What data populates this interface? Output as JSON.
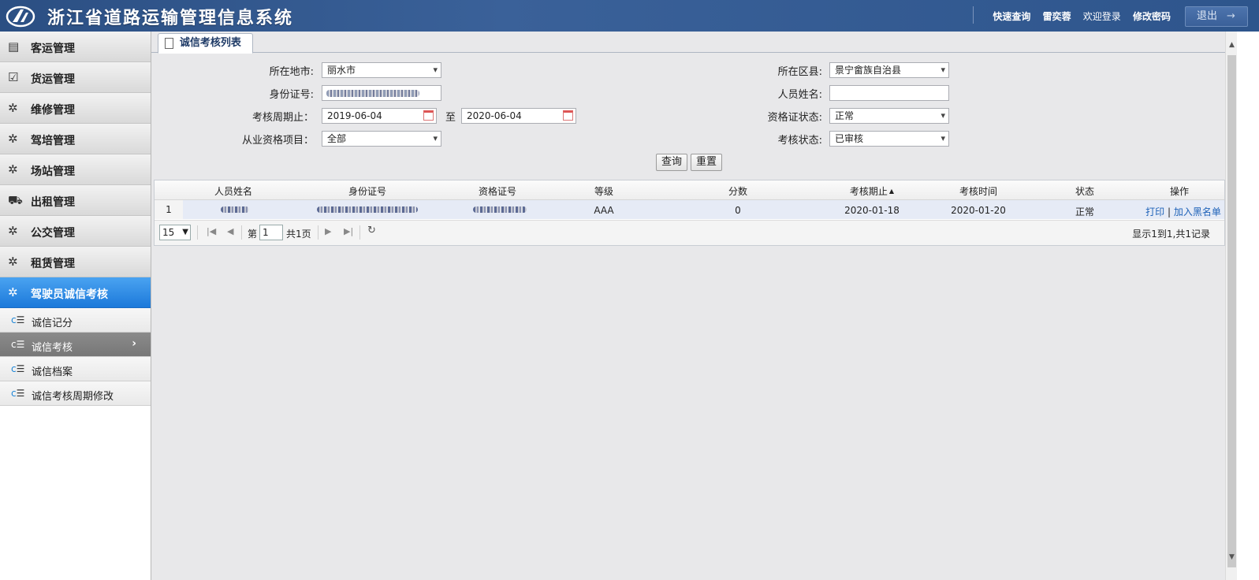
{
  "header": {
    "app_title": "浙江省道路运输管理信息系统",
    "nav": {
      "quick_query": "快速查询",
      "user_name": "雷奕蓉",
      "welcome": "欢迎登录",
      "change_password": "修改密码"
    },
    "logout": "退出",
    "logout_icon": "arrow-right-icon"
  },
  "sidebar": {
    "menus": [
      {
        "label": "客运管理",
        "icon": "bus-icon"
      },
      {
        "label": "货运管理",
        "icon": "checklist-icon"
      },
      {
        "label": "维修管理",
        "icon": "gear-icon"
      },
      {
        "label": "驾培管理",
        "icon": "gear-icon"
      },
      {
        "label": "场站管理",
        "icon": "gear-icon"
      },
      {
        "label": "出租管理",
        "icon": "taxi-icon"
      },
      {
        "label": "公交管理",
        "icon": "gear-icon"
      },
      {
        "label": "租赁管理",
        "icon": "gear-icon"
      },
      {
        "label": "驾驶员诚信考核",
        "icon": "gear-icon",
        "active": true
      }
    ],
    "sub_items": [
      {
        "label": "诚信记分"
      },
      {
        "label": "诚信考核",
        "current": true
      },
      {
        "label": "诚信档案"
      },
      {
        "label": "诚信考核周期修改"
      }
    ]
  },
  "tab": {
    "label": "诚信考核列表"
  },
  "form": {
    "city_label": "所在地市:",
    "city_value": "丽水市",
    "county_label": "所在区县:",
    "county_value": "景宁畲族自治县",
    "id_label": "身份证号:",
    "name_label": "人员姓名:",
    "name_value": "",
    "period_label": "考核周期止：",
    "period_from": "2019-06-04",
    "period_to_label": "至",
    "period_to": "2020-06-04",
    "cert_status_label": "资格证状态:",
    "cert_status_value": "正常",
    "qualification_label": "从业资格项目：",
    "qualification_value": "全部",
    "review_status_label": "考核状态:",
    "review_status_value": "已审核",
    "query_button": "查询",
    "reset_button": "重置"
  },
  "table": {
    "columns": [
      "人员姓名",
      "身份证号",
      "资格证号",
      "等级",
      "分数",
      "考核期止",
      "考核时间",
      "状态",
      "操作"
    ],
    "rows": [
      {
        "index": "1",
        "grade": "AAA",
        "score": "0",
        "period_end": "2020-01-18",
        "review_time": "2020-01-20",
        "status": "正常",
        "print": "打印",
        "blacklist": "加入黑名单"
      }
    ],
    "pager": {
      "page_size": "15",
      "page_prefix": "第",
      "page_number": "1",
      "page_total": "共1页",
      "summary": "显示1到1,共1记录"
    }
  }
}
